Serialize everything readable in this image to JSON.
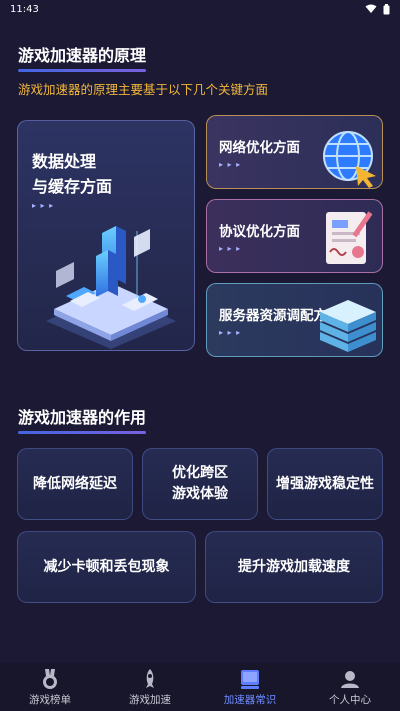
{
  "status_bar": {
    "time": "11:43"
  },
  "principle": {
    "title": "游戏加速器的原理",
    "intro": "游戏加速器的原理主要基于以下几个关键方面",
    "cards": {
      "big": {
        "line1": "数据处理",
        "line2": "与缓存方面"
      },
      "network": {
        "label": "网络优化方面"
      },
      "protocol": {
        "label": "协议优化方面"
      },
      "server": {
        "label": "服务器资源调配方面"
      }
    }
  },
  "role": {
    "title": "游戏加速器的作用",
    "items": [
      {
        "line1": "降低网络延迟"
      },
      {
        "line1": "优化跨区",
        "line2": "游戏体验"
      },
      {
        "line1": "增强游戏稳定性"
      },
      {
        "line1": "减少卡顿和丢包现象"
      },
      {
        "line1": "提升游戏加载速度"
      }
    ]
  },
  "tabbar": {
    "tabs": [
      {
        "label": "游戏榜单",
        "icon": "medal-icon"
      },
      {
        "label": "游戏加速",
        "icon": "rocket-icon"
      },
      {
        "label": "加速器常识",
        "icon": "book-icon",
        "active": true
      },
      {
        "label": "个人中心",
        "icon": "user-icon"
      }
    ]
  },
  "colors": {
    "accent": "#6f8dff",
    "intro_text": "#f1b63a",
    "background": "#1b1933"
  }
}
